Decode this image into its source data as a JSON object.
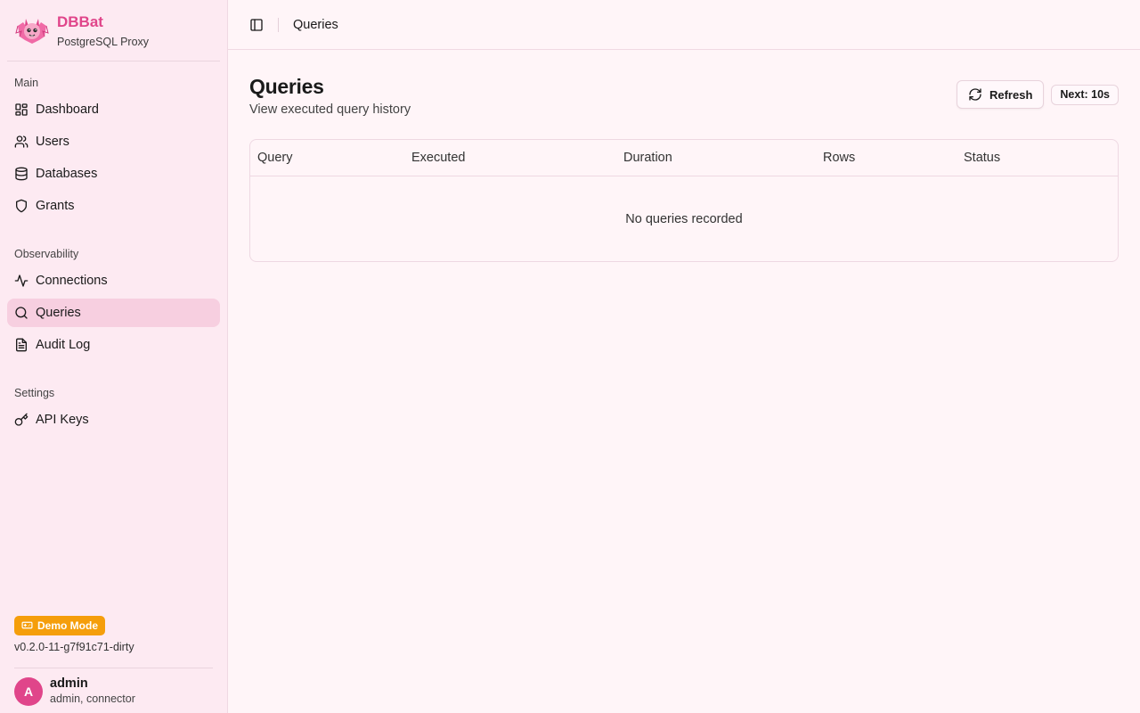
{
  "brand": {
    "name": "DBBat",
    "subtitle": "PostgreSQL Proxy"
  },
  "sidebar": {
    "groups": [
      {
        "label": "Main",
        "items": [
          {
            "label": "Dashboard",
            "icon": "dashboard-icon"
          },
          {
            "label": "Users",
            "icon": "users-icon"
          },
          {
            "label": "Databases",
            "icon": "database-icon"
          },
          {
            "label": "Grants",
            "icon": "shield-icon"
          }
        ]
      },
      {
        "label": "Observability",
        "items": [
          {
            "label": "Connections",
            "icon": "activity-icon"
          },
          {
            "label": "Queries",
            "icon": "search-icon",
            "active": true
          },
          {
            "label": "Audit Log",
            "icon": "file-text-icon"
          }
        ]
      },
      {
        "label": "Settings",
        "items": [
          {
            "label": "API Keys",
            "icon": "key-icon"
          }
        ]
      }
    ]
  },
  "footer": {
    "demo_label": "Demo Mode",
    "version": "v0.2.0-11-g7f91c71-dirty",
    "user": {
      "initial": "A",
      "name": "admin",
      "roles": "admin, connector"
    }
  },
  "topbar": {
    "breadcrumb": "Queries"
  },
  "page": {
    "title": "Queries",
    "description": "View executed query history",
    "refresh_label": "Refresh",
    "next_label": "Next: 10s"
  },
  "table": {
    "columns": [
      "Query",
      "Executed",
      "Duration",
      "Rows",
      "Status"
    ],
    "empty_text": "No queries recorded"
  },
  "colors": {
    "accent": "#e0458a",
    "sidebar_bg": "#fdeaf2",
    "active_bg": "#f7cfe0",
    "demo_badge": "#f59e0b"
  }
}
